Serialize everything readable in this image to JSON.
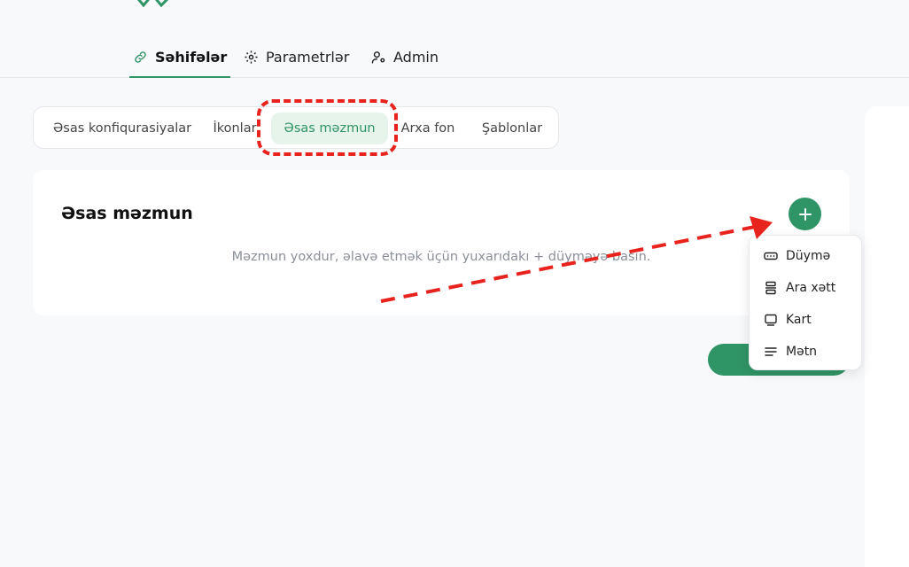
{
  "nav": {
    "tabs": [
      {
        "label": "Səhifələr",
        "icon": "link-icon",
        "active": true
      },
      {
        "label": "Parametrlər",
        "icon": "gear-icon",
        "active": false
      },
      {
        "label": "Admin",
        "icon": "user-gear-icon",
        "active": false
      }
    ]
  },
  "subtabs": {
    "items": [
      {
        "label": "Əsas konfiqurasiyalar",
        "active": false
      },
      {
        "label": "İkonlar",
        "active": false
      },
      {
        "label": "Əsas məzmun",
        "active": true
      },
      {
        "label": "Arxa fon",
        "active": false
      },
      {
        "label": "Şablonlar",
        "active": false
      }
    ]
  },
  "main": {
    "title": "Əsas məzmun",
    "empty_text": "Məzmun yoxdur, əlavə etmək üçün yuxarıdakı + düyməyə basın."
  },
  "dropdown": {
    "items": [
      {
        "label": "Düymə",
        "icon": "button-icon"
      },
      {
        "label": "Ara xətt",
        "icon": "divider-icon"
      },
      {
        "label": "Kart",
        "icon": "card-icon"
      },
      {
        "label": "Mətn",
        "icon": "text-icon"
      }
    ]
  },
  "colors": {
    "accent": "#2f9466",
    "accent_light": "#e6f4ec",
    "annotation": "#e8231d"
  }
}
